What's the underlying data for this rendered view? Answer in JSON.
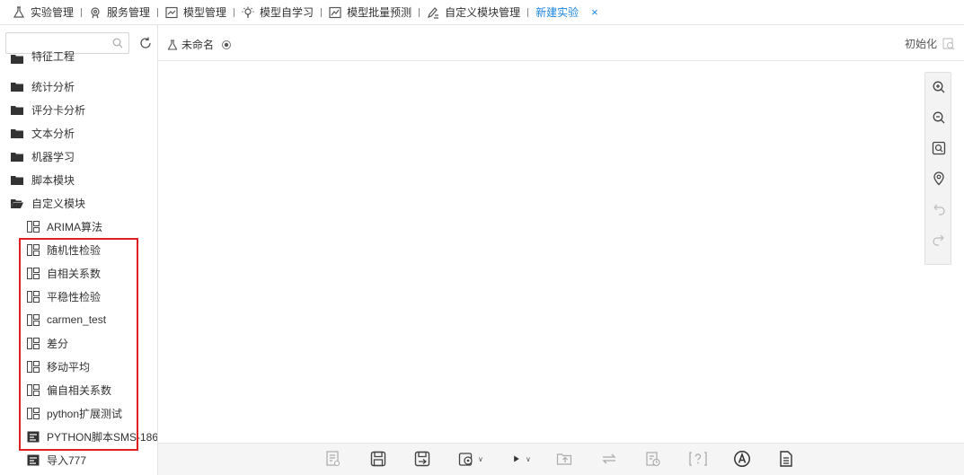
{
  "nav": {
    "items": [
      {
        "label": "实验管理",
        "icon": "flask-icon"
      },
      {
        "label": "服务管理",
        "icon": "service-icon"
      },
      {
        "label": "模型管理",
        "icon": "chart-icon"
      },
      {
        "label": "模型自学习",
        "icon": "bulb-icon"
      },
      {
        "label": "模型批量预测",
        "icon": "trend-icon"
      },
      {
        "label": "自定义模块管理",
        "icon": "edit-icon"
      }
    ],
    "active_tab": "新建实验",
    "close_label": "×"
  },
  "sidebar": {
    "search_placeholder": "",
    "folders": [
      {
        "label": "特征工程"
      },
      {
        "label": "统计分析"
      },
      {
        "label": "评分卡分析"
      },
      {
        "label": "文本分析"
      },
      {
        "label": "机器学习"
      },
      {
        "label": "脚本模块"
      },
      {
        "label": "自定义模块"
      }
    ],
    "modules": [
      {
        "label": "ARIMA算法"
      },
      {
        "label": "随机性检验"
      },
      {
        "label": "自相关系数"
      },
      {
        "label": "平稳性检验"
      },
      {
        "label": "carmen_test"
      },
      {
        "label": "差分"
      },
      {
        "label": "移动平均"
      },
      {
        "label": "偏自相关系数"
      },
      {
        "label": "python扩展测试"
      },
      {
        "label": "PYTHON脚本SMS-186"
      },
      {
        "label": "导入777"
      }
    ]
  },
  "header": {
    "experiment_title": "未命名",
    "init_label": "初始化"
  },
  "zoom_tools": [
    "zoom-in-icon",
    "zoom-out-icon",
    "fit-view-icon",
    "locate-icon",
    "undo-icon",
    "redo-icon"
  ],
  "toolbar": [
    "report-icon",
    "save-icon",
    "save-as-icon",
    "settings-icon",
    "run-icon",
    "import-icon",
    "swap-icon",
    "schedule-icon",
    "help-icon",
    "text-a-icon",
    "document-icon"
  ]
}
